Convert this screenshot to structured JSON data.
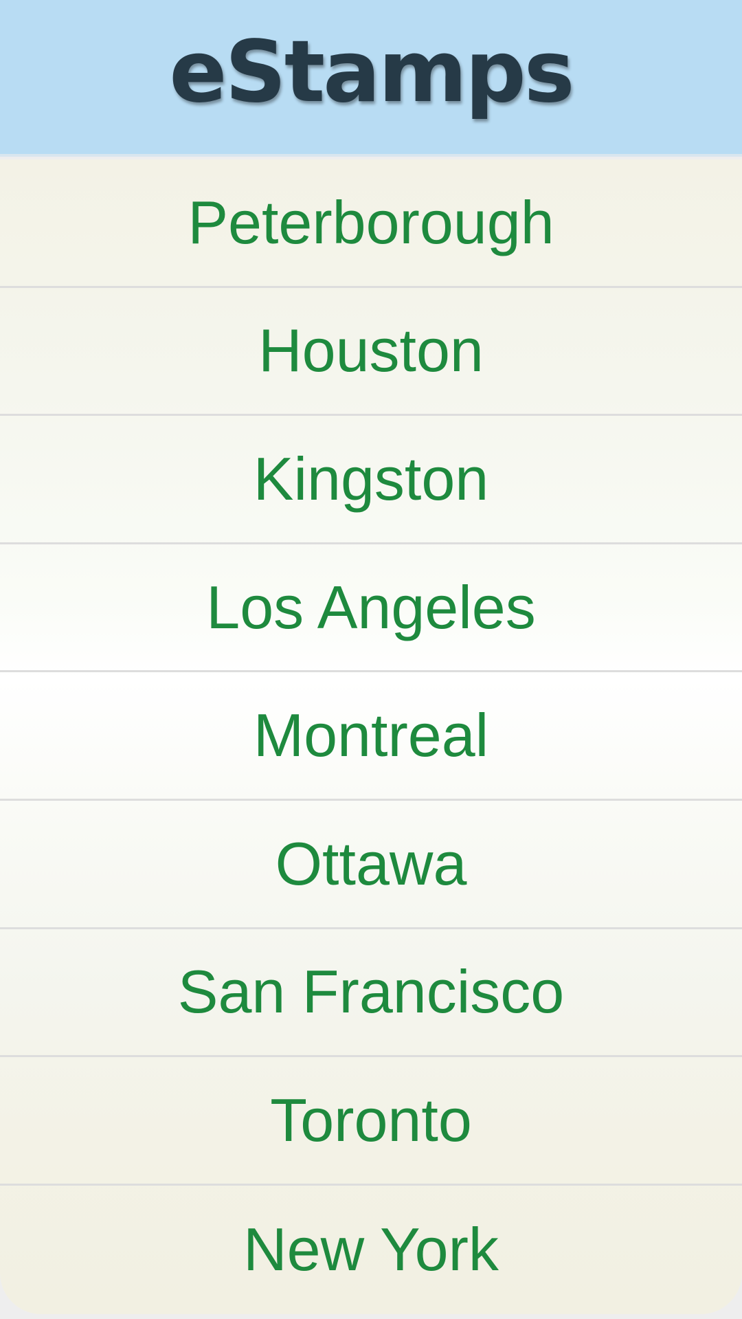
{
  "header": {
    "title": "eStamps"
  },
  "cities": [
    "Peterborough",
    "Houston",
    "Kingston",
    "Los Angeles",
    "Montreal",
    "Ottawa",
    "San Francisco",
    "Toronto",
    "New York"
  ],
  "colors": {
    "header_background": "#b8dcf3",
    "title_text": "#263a47",
    "city_text": "#1e8a3e",
    "divider": "#dddddd"
  }
}
